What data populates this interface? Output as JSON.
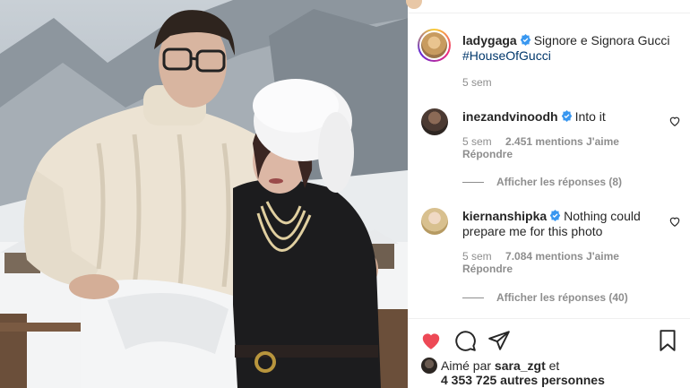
{
  "post": {
    "author": "ladygaga",
    "caption": "Signore e Signora Gucci",
    "hashtag": "#HouseOfGucci",
    "age": "5 sem"
  },
  "comments": [
    {
      "author": "inezandvinoodh",
      "text": "Into it",
      "age": "5 sem",
      "likes": "2.451 mentions J'aime",
      "reply": "Répondre",
      "view_replies": "Afficher les réponses (8)"
    },
    {
      "author": "kiernanshipka",
      "text": "Nothing could prepare me for this photo",
      "age": "5 sem",
      "likes": "7.084 mentions J'aime",
      "reply": "Répondre",
      "view_replies": "Afficher les réponses (40)"
    }
  ],
  "likes": {
    "prefix": "Aimé par",
    "user": "sara_zgt",
    "conj": "et",
    "others": "4 353 725 autres personnes"
  },
  "icons": {
    "like": "heart-filled-icon",
    "comment": "comment-icon",
    "share": "share-icon",
    "save": "bookmark-icon",
    "verified": "verified-badge-icon"
  },
  "colors": {
    "liked_red": "#ed4956",
    "verified_blue": "#3897f0",
    "muted": "#8e8e8e",
    "link": "#00376b"
  }
}
